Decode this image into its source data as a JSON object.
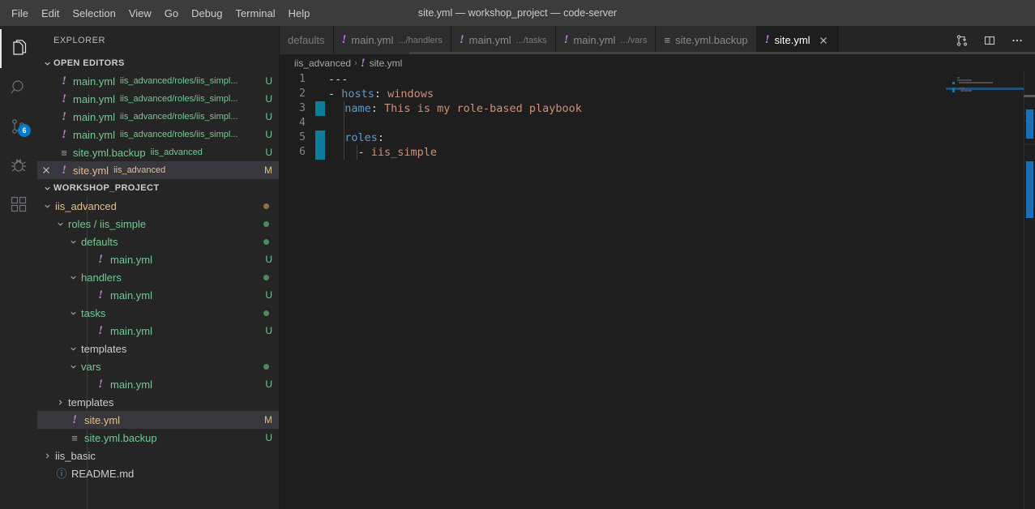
{
  "titlebar": {
    "title": "site.yml — workshop_project — code-server",
    "menus": [
      "File",
      "Edit",
      "Selection",
      "View",
      "Go",
      "Debug",
      "Terminal",
      "Help"
    ]
  },
  "activitybar": {
    "items": [
      {
        "name": "explorer",
        "icon": "files-icon",
        "active": true,
        "badge": ""
      },
      {
        "name": "search",
        "icon": "search-icon",
        "active": false,
        "badge": ""
      },
      {
        "name": "source-control",
        "icon": "source-control-icon",
        "active": false,
        "badge": "6"
      },
      {
        "name": "debug",
        "icon": "debug-icon",
        "active": false,
        "badge": ""
      },
      {
        "name": "extensions",
        "icon": "extensions-icon",
        "active": false,
        "badge": ""
      }
    ]
  },
  "sidebar": {
    "title": "EXPLORER",
    "open_editors": {
      "header": "OPEN EDITORS",
      "items": [
        {
          "icon": "yaml-icon",
          "label": "main.yml",
          "desc": "iis_advanced/roles/iis_simpl...",
          "status": "U",
          "color": "untracked",
          "selected": false,
          "close": false
        },
        {
          "icon": "yaml-icon",
          "label": "main.yml",
          "desc": "iis_advanced/roles/iis_simpl...",
          "status": "U",
          "color": "untracked",
          "selected": false,
          "close": false
        },
        {
          "icon": "yaml-icon",
          "label": "main.yml",
          "desc": "iis_advanced/roles/iis_simpl...",
          "status": "U",
          "color": "untracked",
          "selected": false,
          "close": false
        },
        {
          "icon": "yaml-icon",
          "label": "main.yml",
          "desc": "iis_advanced/roles/iis_simpl...",
          "status": "U",
          "color": "untracked",
          "selected": false,
          "close": false
        },
        {
          "icon": "lines-icon",
          "label": "site.yml.backup",
          "desc": "iis_advanced",
          "status": "U",
          "color": "untracked",
          "selected": false,
          "close": false
        },
        {
          "icon": "yaml-icon",
          "label": "site.yml",
          "desc": "iis_advanced",
          "status": "M",
          "color": "modified",
          "selected": true,
          "close": true
        }
      ]
    },
    "workspace": {
      "header": "WORKSHOP_PROJECT",
      "items": [
        {
          "indent": 1,
          "twisty": "down",
          "icon": "",
          "label": "iis_advanced",
          "color": "modified",
          "dot": "modified",
          "status": "",
          "selected": false
        },
        {
          "indent": 2,
          "twisty": "down",
          "icon": "",
          "label": "roles / iis_simple",
          "color": "untracked",
          "dot": "untracked",
          "status": "",
          "selected": false
        },
        {
          "indent": 3,
          "twisty": "down",
          "icon": "",
          "label": "defaults",
          "color": "untracked",
          "dot": "untracked",
          "status": "",
          "selected": false
        },
        {
          "indent": 4,
          "twisty": "none",
          "icon": "yaml-icon",
          "label": "main.yml",
          "color": "untracked",
          "dot": "",
          "status": "U",
          "selected": false
        },
        {
          "indent": 3,
          "twisty": "down",
          "icon": "",
          "label": "handlers",
          "color": "untracked",
          "dot": "untracked",
          "status": "",
          "selected": false
        },
        {
          "indent": 4,
          "twisty": "none",
          "icon": "yaml-icon",
          "label": "main.yml",
          "color": "untracked",
          "dot": "",
          "status": "U",
          "selected": false
        },
        {
          "indent": 3,
          "twisty": "down",
          "icon": "",
          "label": "tasks",
          "color": "untracked",
          "dot": "untracked",
          "status": "",
          "selected": false
        },
        {
          "indent": 4,
          "twisty": "none",
          "icon": "yaml-icon",
          "label": "main.yml",
          "color": "untracked",
          "dot": "",
          "status": "U",
          "selected": false
        },
        {
          "indent": 3,
          "twisty": "down",
          "icon": "",
          "label": "templates",
          "color": "plain",
          "dot": "",
          "status": "",
          "selected": false
        },
        {
          "indent": 3,
          "twisty": "down",
          "icon": "",
          "label": "vars",
          "color": "untracked",
          "dot": "untracked",
          "status": "",
          "selected": false
        },
        {
          "indent": 4,
          "twisty": "none",
          "icon": "yaml-icon",
          "label": "main.yml",
          "color": "untracked",
          "dot": "",
          "status": "U",
          "selected": false
        },
        {
          "indent": 2,
          "twisty": "right",
          "icon": "",
          "label": "templates",
          "color": "plain",
          "dot": "",
          "status": "",
          "selected": false
        },
        {
          "indent": 2,
          "twisty": "none",
          "icon": "yaml-icon",
          "label": "site.yml",
          "color": "modified",
          "dot": "",
          "status": "M",
          "selected": true
        },
        {
          "indent": 2,
          "twisty": "none",
          "icon": "lines-icon",
          "label": "site.yml.backup",
          "color": "untracked",
          "dot": "",
          "status": "U",
          "selected": false
        },
        {
          "indent": 1,
          "twisty": "right",
          "icon": "",
          "label": "iis_basic",
          "color": "plain",
          "dot": "",
          "status": "",
          "selected": false
        },
        {
          "indent": 1,
          "twisty": "none",
          "icon": "md-icon",
          "label": "README.md",
          "color": "plain",
          "dot": "",
          "status": "",
          "selected": false
        }
      ]
    }
  },
  "tabs": {
    "partial_label": "defaults",
    "items": [
      {
        "icon": "yaml-icon",
        "label": "main.yml",
        "desc": ".../handlers",
        "active": false,
        "close": false
      },
      {
        "icon": "yaml-icon",
        "label": "main.yml",
        "desc": ".../tasks",
        "active": false,
        "close": false
      },
      {
        "icon": "yaml-icon",
        "label": "main.yml",
        "desc": ".../vars",
        "active": false,
        "close": false
      },
      {
        "icon": "lines-icon",
        "label": "site.yml.backup",
        "desc": "",
        "active": false,
        "close": false
      },
      {
        "icon": "yaml-icon",
        "label": "site.yml",
        "desc": "",
        "active": true,
        "close": true
      }
    ],
    "actions": [
      {
        "name": "open-changes-button",
        "icon": "compare-changes-icon"
      },
      {
        "name": "split-editor-button",
        "icon": "split-editor-icon"
      },
      {
        "name": "more-actions-button",
        "icon": "ellipsis-icon"
      }
    ]
  },
  "breadcrumbs": {
    "root": "iis_advanced",
    "separator": "›",
    "file": "site.yml"
  },
  "editor": {
    "language": "yaml",
    "lines": [
      {
        "n": "1",
        "modified": false,
        "tokens": [
          {
            "t": "---",
            "c": "tok-dash"
          }
        ]
      },
      {
        "n": "2",
        "modified": false,
        "tokens": [
          {
            "t": "- ",
            "c": "tok-dash"
          },
          {
            "t": "hosts",
            "c": "tok-key"
          },
          {
            "t": ":",
            "c": "tok-punc"
          },
          {
            "t": " windows",
            "c": "tok-str"
          }
        ]
      },
      {
        "n": "3",
        "modified": true,
        "tokens": [
          {
            "t": "  ",
            "c": "tok-punc"
          },
          {
            "t": "name",
            "c": "tok-key"
          },
          {
            "t": ":",
            "c": "tok-punc"
          },
          {
            "t": " This is my role-based playbook",
            "c": "tok-str"
          }
        ]
      },
      {
        "n": "4",
        "modified": false,
        "tokens": [
          {
            "t": "",
            "c": "tok-punc"
          }
        ]
      },
      {
        "n": "5",
        "modified": true,
        "tokens": [
          {
            "t": "  ",
            "c": "tok-punc"
          },
          {
            "t": "roles",
            "c": "tok-key"
          },
          {
            "t": ":",
            "c": "tok-punc"
          }
        ]
      },
      {
        "n": "6",
        "modified": true,
        "tokens": [
          {
            "t": "    - ",
            "c": "tok-dash"
          },
          {
            "t": "iis_simple",
            "c": "tok-str"
          }
        ]
      }
    ]
  },
  "colors": {
    "accent": "#007acc",
    "untracked": "#73c991",
    "modified": "#e2c08d",
    "yaml_icon": "#c679dd",
    "editor_bg": "#1e1e1e",
    "sidebar_bg": "#252526",
    "titlebar_bg": "#3c3c3c",
    "selection_bg": "#37373d",
    "gutter_modified": "#0c7d9d",
    "overview_mark": "#1b6fb5"
  }
}
